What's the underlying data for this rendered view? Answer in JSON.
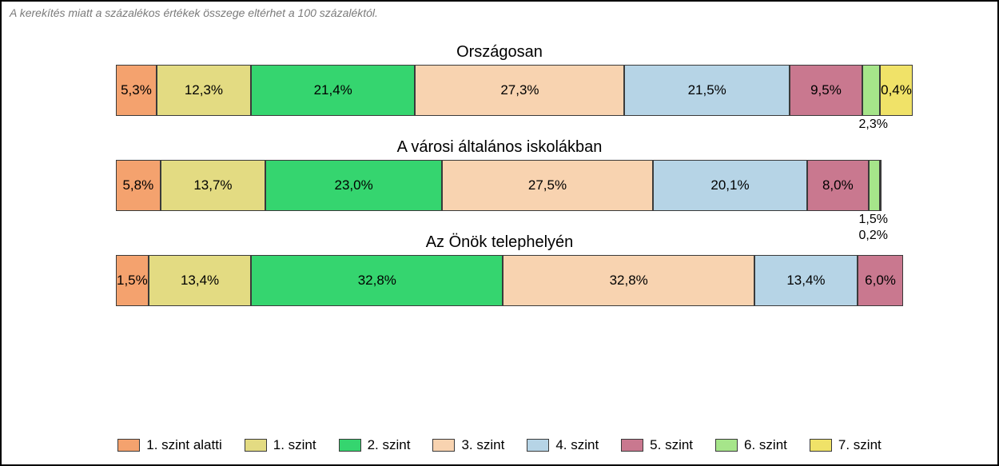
{
  "note": "A kerekítés miatt a százalékos értékek összege eltérhet a 100 százaléktól.",
  "legend": [
    {
      "label": "1. szint alatti",
      "class": "c0"
    },
    {
      "label": "1. szint",
      "class": "c1"
    },
    {
      "label": "2. szint",
      "class": "c2"
    },
    {
      "label": "3. szint",
      "class": "c3"
    },
    {
      "label": "4. szint",
      "class": "c4"
    },
    {
      "label": "5. szint",
      "class": "c5"
    },
    {
      "label": "6. szint",
      "class": "c6"
    },
    {
      "label": "7. szint",
      "class": "c7"
    }
  ],
  "chart_data": {
    "type": "bar",
    "stacked": true,
    "orientation": "horizontal",
    "unit": "%",
    "series_names": [
      "1. szint alatti",
      "1. szint",
      "2. szint",
      "3. szint",
      "4. szint",
      "5. szint",
      "6. szint",
      "7. szint"
    ],
    "rows": [
      {
        "title": "Országosan",
        "values": [
          5.3,
          12.3,
          21.4,
          27.3,
          21.5,
          9.5,
          2.3,
          0.4
        ],
        "labels": [
          "5,3%",
          "12,3%",
          "21,4%",
          "27,3%",
          "21,5%",
          "9,5%",
          "2,3%",
          "0,4%"
        ],
        "below": [
          null,
          null,
          null,
          null,
          null,
          null,
          "2,3%",
          null
        ],
        "inline": [
          "5,3%",
          "12,3%",
          "21,4%",
          "27,3%",
          "21,5%",
          "9,5%",
          "",
          "0,4%"
        ]
      },
      {
        "title": "A városi általános iskolákban",
        "values": [
          5.8,
          13.7,
          23.0,
          27.5,
          20.1,
          8.0,
          1.5,
          0.2
        ],
        "labels": [
          "5,8%",
          "13,7%",
          "23,0%",
          "27,5%",
          "20,1%",
          "8,0%",
          "1,5%",
          "0,2%"
        ],
        "below": [
          null,
          null,
          null,
          null,
          null,
          null,
          "1,5%",
          "0,2%"
        ],
        "inline": [
          "5,8%",
          "13,7%",
          "23,0%",
          "27,5%",
          "20,1%",
          "8,0%",
          "",
          ""
        ]
      },
      {
        "title": "Az Önök telephelyén",
        "values": [
          1.5,
          13.4,
          32.8,
          32.8,
          13.4,
          6.0,
          0,
          0
        ],
        "labels": [
          "1,5%",
          "13,4%",
          "32,8%",
          "32,8%",
          "13,4%",
          "6,0%",
          "",
          ""
        ],
        "below": [
          null,
          null,
          null,
          null,
          null,
          null,
          null,
          null
        ],
        "inline": [
          "1,5%",
          "13,4%",
          "32,8%",
          "32,8%",
          "13,4%",
          "6,0%",
          "",
          ""
        ]
      }
    ]
  }
}
